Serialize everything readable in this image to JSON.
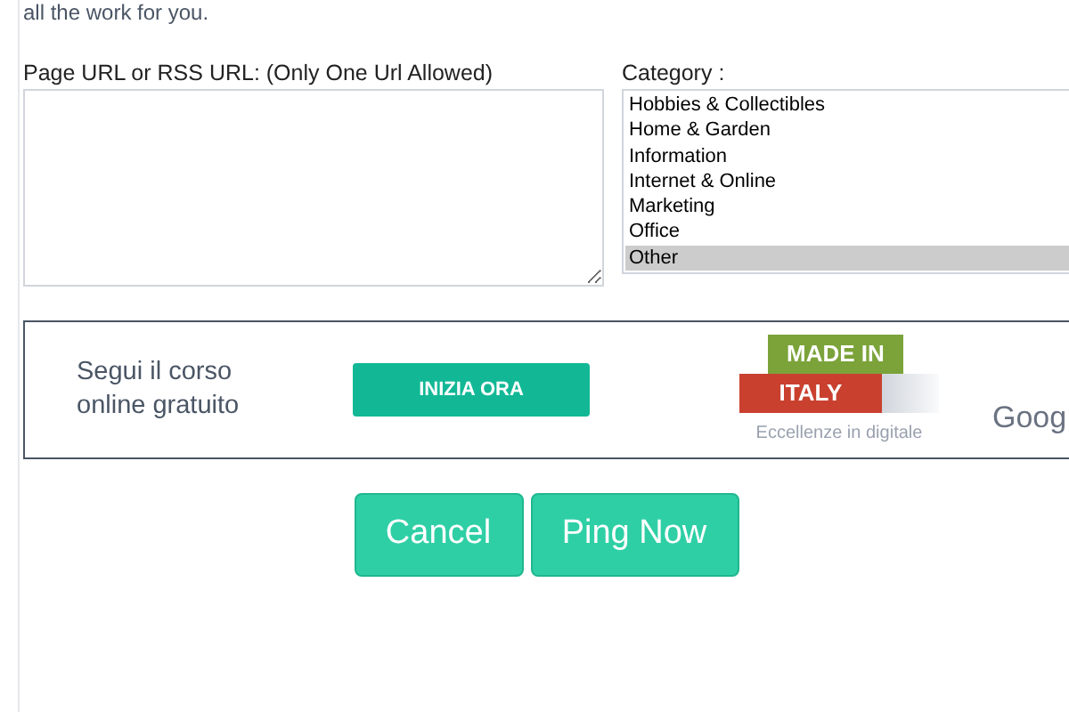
{
  "intro_text": "all the work for you.",
  "url_field": {
    "label": "Page URL or RSS URL: (Only One Url Allowed)"
  },
  "category": {
    "label": "Category :",
    "options": [
      {
        "label": "Hobbies & Collectibles",
        "selected": false
      },
      {
        "label": "Home & Garden",
        "selected": false
      },
      {
        "label": "Information",
        "selected": false
      },
      {
        "label": "Internet & Online",
        "selected": false
      },
      {
        "label": "Marketing",
        "selected": false
      },
      {
        "label": "Office",
        "selected": false
      },
      {
        "label": "Other",
        "selected": true
      }
    ]
  },
  "ad_banner": {
    "text": "Segui il corso online gratuito",
    "button": "INIZIA ORA",
    "logo_top": "MADE IN",
    "logo_bottom": "ITALY",
    "logo_caption": "Eccellenze in digitale",
    "brand": "Goog"
  },
  "buttons": [
    "Cancel",
    "Ping Now"
  ]
}
